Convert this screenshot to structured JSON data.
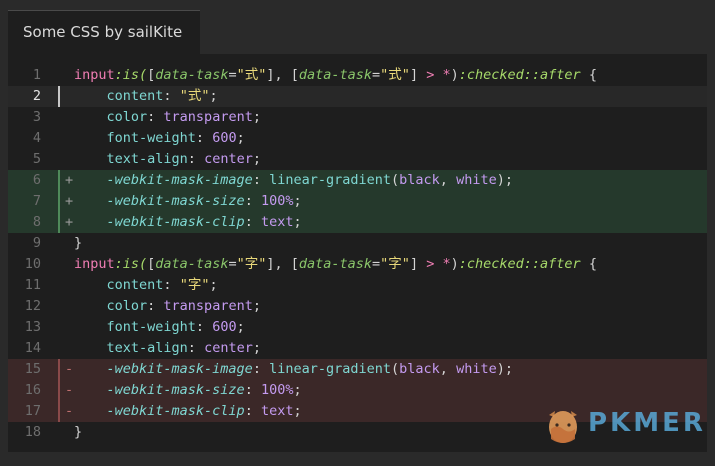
{
  "tab": {
    "title": "Some CSS by sailKite"
  },
  "code": {
    "lines": [
      {
        "n": "1",
        "marker": "",
        "tokens": [
          {
            "t": "input",
            "c": "tag"
          },
          {
            "t": ":is(",
            "c": "pseudo"
          },
          {
            "t": "[",
            "c": "punct"
          },
          {
            "t": "data-task",
            "c": "attr"
          },
          {
            "t": "=",
            "c": "punct"
          },
          {
            "t": "\"式\"",
            "c": "str"
          },
          {
            "t": "], [",
            "c": "punct"
          },
          {
            "t": "data-task",
            "c": "attr"
          },
          {
            "t": "=",
            "c": "punct"
          },
          {
            "t": "\"式\"",
            "c": "str"
          },
          {
            "t": "] ",
            "c": "punct"
          },
          {
            "t": ">",
            "c": "op"
          },
          {
            "t": " ",
            "c": "punct"
          },
          {
            "t": "*",
            "c": "op"
          },
          {
            "t": ")",
            "c": "punct"
          },
          {
            "t": ":checked::after",
            "c": "pseudo"
          },
          {
            "t": " {",
            "c": "punct"
          }
        ]
      },
      {
        "n": "2",
        "marker": "",
        "tokens": [
          {
            "t": "    ",
            "c": "punct"
          },
          {
            "t": "content",
            "c": "prop"
          },
          {
            "t": ": ",
            "c": "punct"
          },
          {
            "t": "\"式\"",
            "c": "str"
          },
          {
            "t": ";",
            "c": "punct"
          }
        ]
      },
      {
        "n": "3",
        "marker": "",
        "tokens": [
          {
            "t": "    ",
            "c": "punct"
          },
          {
            "t": "color",
            "c": "prop"
          },
          {
            "t": ": ",
            "c": "punct"
          },
          {
            "t": "transparent",
            "c": "val"
          },
          {
            "t": ";",
            "c": "punct"
          }
        ]
      },
      {
        "n": "4",
        "marker": "",
        "tokens": [
          {
            "t": "    ",
            "c": "punct"
          },
          {
            "t": "font-weight",
            "c": "prop"
          },
          {
            "t": ": ",
            "c": "punct"
          },
          {
            "t": "600",
            "c": "val"
          },
          {
            "t": ";",
            "c": "punct"
          }
        ]
      },
      {
        "n": "5",
        "marker": "",
        "tokens": [
          {
            "t": "    ",
            "c": "punct"
          },
          {
            "t": "text-align",
            "c": "prop"
          },
          {
            "t": ": ",
            "c": "punct"
          },
          {
            "t": "center",
            "c": "val"
          },
          {
            "t": ";",
            "c": "punct"
          }
        ]
      },
      {
        "n": "6",
        "marker": "+",
        "tokens": [
          {
            "t": "    ",
            "c": "punct"
          },
          {
            "t": "-webkit-mask-image",
            "c": "vprop"
          },
          {
            "t": ": ",
            "c": "punct"
          },
          {
            "t": "linear-gradient",
            "c": "fn"
          },
          {
            "t": "(",
            "c": "punct"
          },
          {
            "t": "black",
            "c": "val"
          },
          {
            "t": ", ",
            "c": "punct"
          },
          {
            "t": "white",
            "c": "val"
          },
          {
            "t": ");",
            "c": "punct"
          }
        ]
      },
      {
        "n": "7",
        "marker": "+",
        "tokens": [
          {
            "t": "    ",
            "c": "punct"
          },
          {
            "t": "-webkit-mask-size",
            "c": "vprop"
          },
          {
            "t": ": ",
            "c": "punct"
          },
          {
            "t": "100%",
            "c": "val"
          },
          {
            "t": ";",
            "c": "punct"
          }
        ]
      },
      {
        "n": "8",
        "marker": "+",
        "tokens": [
          {
            "t": "    ",
            "c": "punct"
          },
          {
            "t": "-webkit-mask-clip",
            "c": "vprop"
          },
          {
            "t": ": ",
            "c": "punct"
          },
          {
            "t": "text",
            "c": "val"
          },
          {
            "t": ";",
            "c": "punct"
          }
        ]
      },
      {
        "n": "9",
        "marker": "",
        "tokens": [
          {
            "t": "}",
            "c": "punct"
          }
        ]
      },
      {
        "n": "10",
        "marker": "",
        "tokens": [
          {
            "t": "input",
            "c": "tag"
          },
          {
            "t": ":is(",
            "c": "pseudo"
          },
          {
            "t": "[",
            "c": "punct"
          },
          {
            "t": "data-task",
            "c": "attr"
          },
          {
            "t": "=",
            "c": "punct"
          },
          {
            "t": "\"字\"",
            "c": "str"
          },
          {
            "t": "], [",
            "c": "punct"
          },
          {
            "t": "data-task",
            "c": "attr"
          },
          {
            "t": "=",
            "c": "punct"
          },
          {
            "t": "\"字\"",
            "c": "str"
          },
          {
            "t": "] ",
            "c": "punct"
          },
          {
            "t": ">",
            "c": "op"
          },
          {
            "t": " ",
            "c": "punct"
          },
          {
            "t": "*",
            "c": "op"
          },
          {
            "t": ")",
            "c": "punct"
          },
          {
            "t": ":checked::after",
            "c": "pseudo"
          },
          {
            "t": " {",
            "c": "punct"
          }
        ]
      },
      {
        "n": "11",
        "marker": "",
        "tokens": [
          {
            "t": "    ",
            "c": "punct"
          },
          {
            "t": "content",
            "c": "prop"
          },
          {
            "t": ": ",
            "c": "punct"
          },
          {
            "t": "\"字\"",
            "c": "str"
          },
          {
            "t": ";",
            "c": "punct"
          }
        ]
      },
      {
        "n": "12",
        "marker": "",
        "tokens": [
          {
            "t": "    ",
            "c": "punct"
          },
          {
            "t": "color",
            "c": "prop"
          },
          {
            "t": ": ",
            "c": "punct"
          },
          {
            "t": "transparent",
            "c": "val"
          },
          {
            "t": ";",
            "c": "punct"
          }
        ]
      },
      {
        "n": "13",
        "marker": "",
        "tokens": [
          {
            "t": "    ",
            "c": "punct"
          },
          {
            "t": "font-weight",
            "c": "prop"
          },
          {
            "t": ": ",
            "c": "punct"
          },
          {
            "t": "600",
            "c": "val"
          },
          {
            "t": ";",
            "c": "punct"
          }
        ]
      },
      {
        "n": "14",
        "marker": "",
        "tokens": [
          {
            "t": "    ",
            "c": "punct"
          },
          {
            "t": "text-align",
            "c": "prop"
          },
          {
            "t": ": ",
            "c": "punct"
          },
          {
            "t": "center",
            "c": "val"
          },
          {
            "t": ";",
            "c": "punct"
          }
        ]
      },
      {
        "n": "15",
        "marker": "-",
        "tokens": [
          {
            "t": "    ",
            "c": "punct"
          },
          {
            "t": "-webkit-mask-image",
            "c": "vprop"
          },
          {
            "t": ": ",
            "c": "punct"
          },
          {
            "t": "linear-gradient",
            "c": "fn"
          },
          {
            "t": "(",
            "c": "punct"
          },
          {
            "t": "black",
            "c": "val"
          },
          {
            "t": ", ",
            "c": "punct"
          },
          {
            "t": "white",
            "c": "val"
          },
          {
            "t": ");",
            "c": "punct"
          }
        ]
      },
      {
        "n": "16",
        "marker": "-",
        "tokens": [
          {
            "t": "    ",
            "c": "punct"
          },
          {
            "t": "-webkit-mask-size",
            "c": "vprop"
          },
          {
            "t": ": ",
            "c": "punct"
          },
          {
            "t": "100%",
            "c": "val"
          },
          {
            "t": ";",
            "c": "punct"
          }
        ]
      },
      {
        "n": "17",
        "marker": "-",
        "tokens": [
          {
            "t": "    ",
            "c": "punct"
          },
          {
            "t": "-webkit-mask-clip",
            "c": "vprop"
          },
          {
            "t": ": ",
            "c": "punct"
          },
          {
            "t": "text",
            "c": "val"
          },
          {
            "t": ";",
            "c": "punct"
          }
        ]
      },
      {
        "n": "18",
        "marker": "",
        "tokens": [
          {
            "t": "}",
            "c": "punct"
          }
        ]
      }
    ]
  },
  "watermark": {
    "text": "PKMER",
    "icon": "pkmer-egg-logo-icon",
    "color": "#5bb0e0"
  },
  "colors": {
    "background": "#1e1e1e",
    "added_line": "#25392c",
    "removed_line": "#3b2828",
    "selector": "#f07eb4",
    "string": "#e8d87a",
    "property": "#7fd7d2",
    "value": "#c49bf0",
    "pseudo": "#a6d96a"
  }
}
